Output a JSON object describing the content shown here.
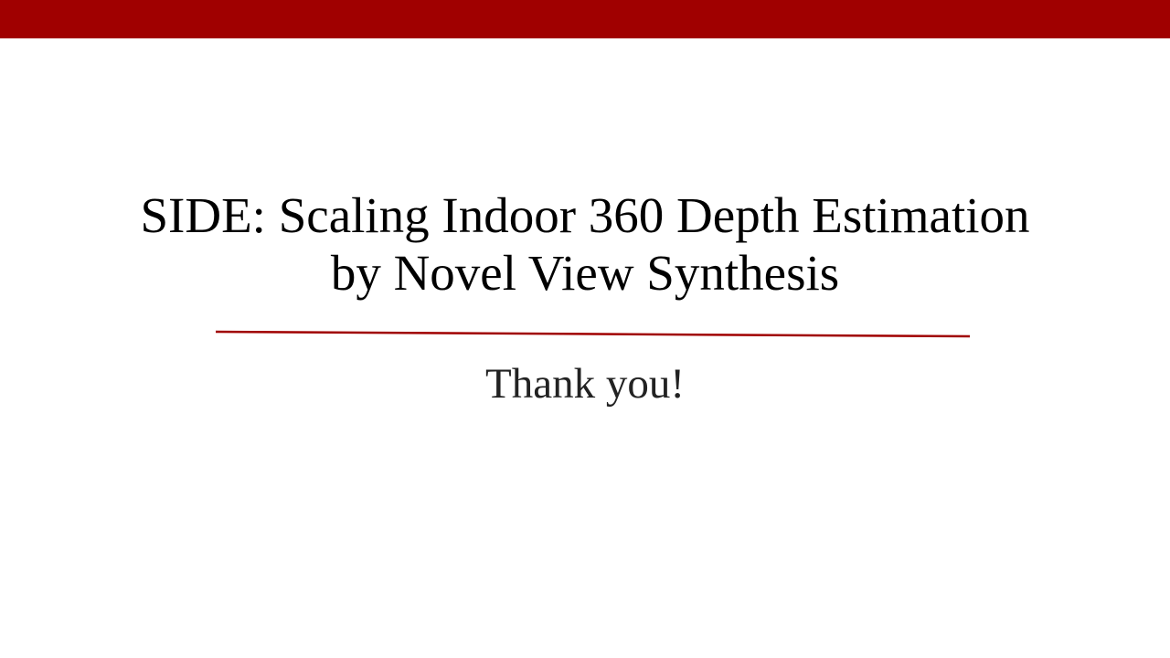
{
  "slide": {
    "title_line1": "SIDE: Scaling Indoor 360 Depth Estimation",
    "title_line2": "by Novel View Synthesis",
    "subtitle": "Thank you!"
  },
  "colors": {
    "accent": "#a00000",
    "background": "#ffffff",
    "title_text": "#000000",
    "subtitle_text": "#222222"
  }
}
